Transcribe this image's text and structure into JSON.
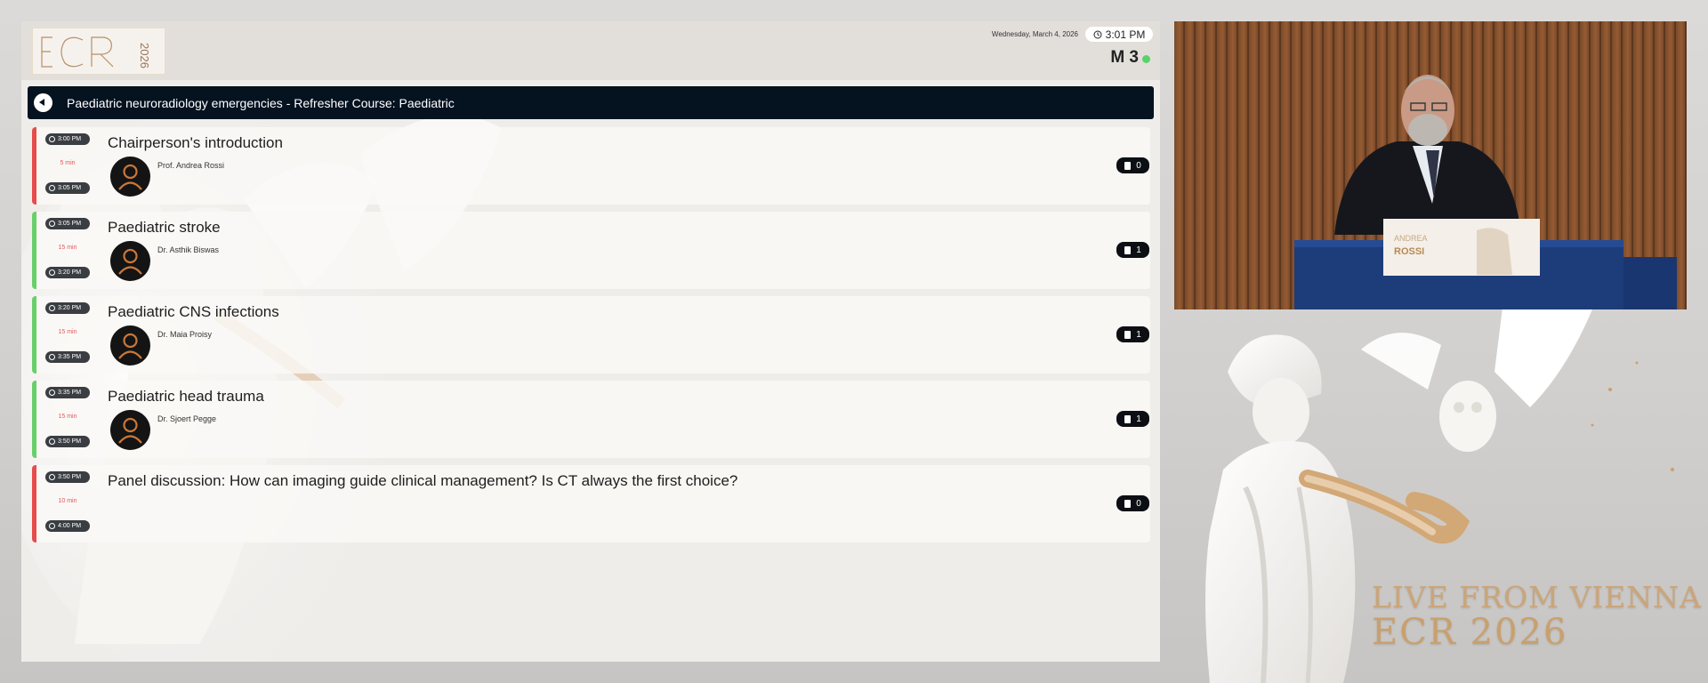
{
  "header": {
    "logo_text": "ECR 2026",
    "date": "Wednesday, March 4, 2026",
    "time": "3:01 PM",
    "room": "M 3",
    "status_color": "#5ad16a"
  },
  "session": {
    "title": "Paediatric neuroradiology emergencies - Refresher Course: Paediatric",
    "back_icon": "back-arrow-icon"
  },
  "agenda": [
    {
      "title": "Chairperson's introduction",
      "start": "3:00 PM",
      "end": "3:05 PM",
      "duration": "5 min",
      "speaker": "Prof. Andrea Rossi",
      "documents": "0",
      "status": "red"
    },
    {
      "title": "Paediatric stroke",
      "start": "3:05 PM",
      "end": "3:20 PM",
      "duration": "15 min",
      "speaker": "Dr. Asthik Biswas",
      "documents": "1",
      "status": "green"
    },
    {
      "title": "Paediatric CNS infections",
      "start": "3:20 PM",
      "end": "3:35 PM",
      "duration": "15 min",
      "speaker": "Dr. Maia Proisy",
      "documents": "1",
      "status": "green"
    },
    {
      "title": "Paediatric head trauma",
      "start": "3:35 PM",
      "end": "3:50 PM",
      "duration": "15 min",
      "speaker": "Dr. Sjoert Pegge",
      "documents": "1",
      "status": "green"
    },
    {
      "title": "Panel discussion: How can imaging guide clinical management? Is CT always the first choice?",
      "start": "3:50 PM",
      "end": "4:00 PM",
      "duration": "10 min",
      "speaker": "",
      "documents": "0",
      "status": "red"
    }
  ],
  "video": {
    "lectern_first_name": "ANDREA",
    "lectern_last_name": "ROSSI"
  },
  "branding": {
    "live_text": "LIVE FROM VIENNA",
    "event_text": "ECR 2026",
    "gold": "#caa57a"
  }
}
